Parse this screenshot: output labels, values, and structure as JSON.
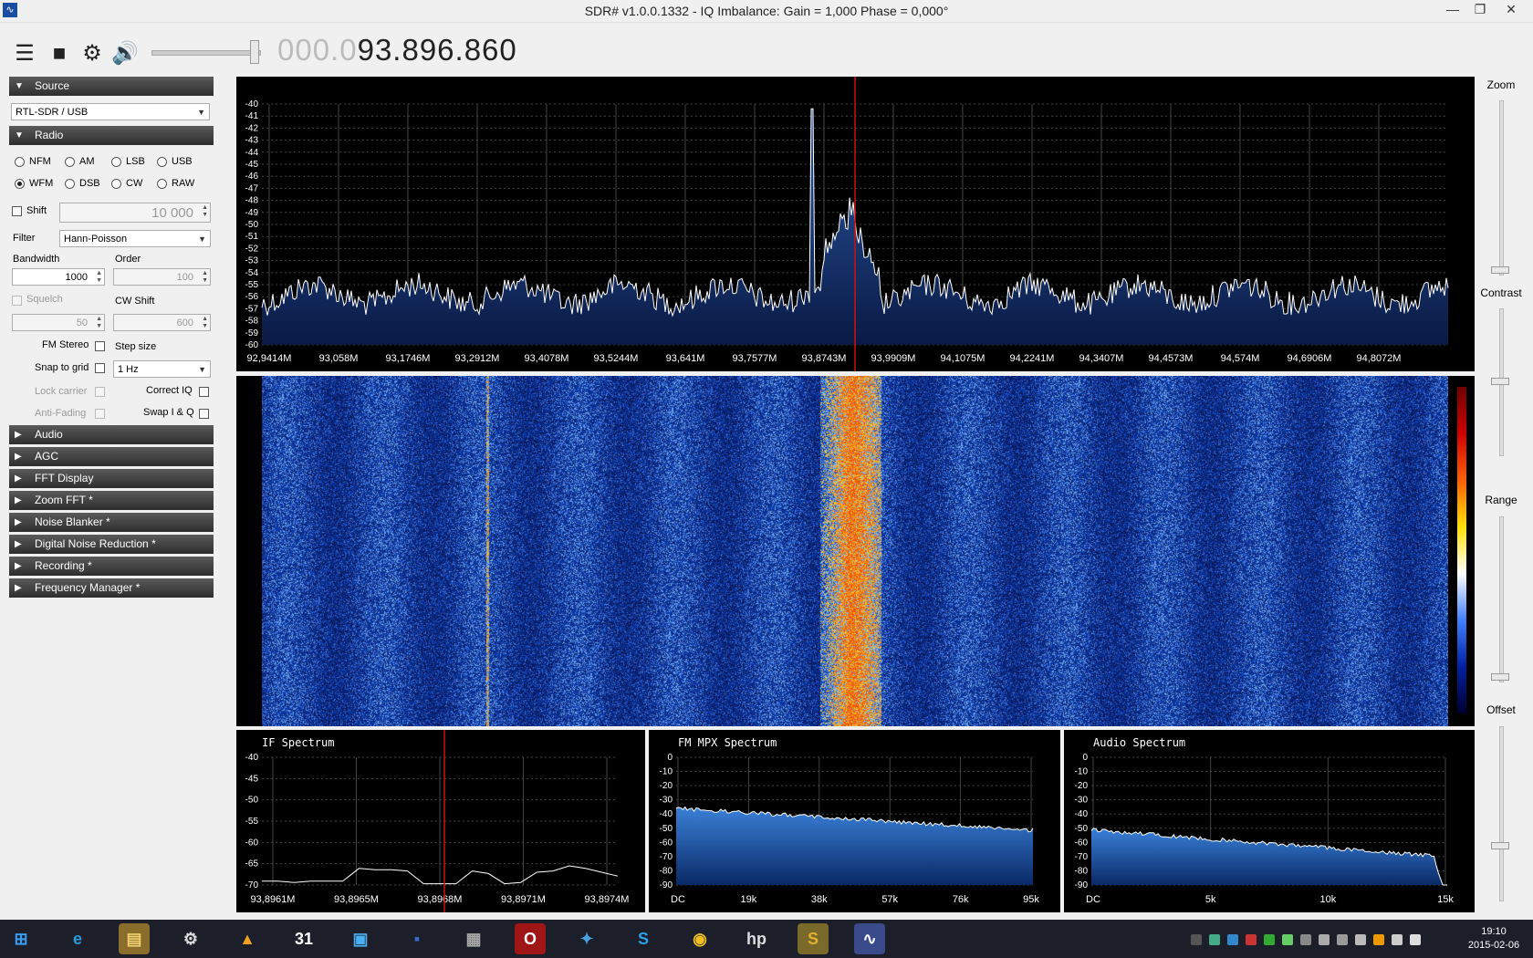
{
  "window": {
    "title": "SDR# v1.0.0.1332 - IQ Imbalance: Gain = 1,000 Phase = 0,000°",
    "controls": [
      "minimize-icon",
      "restore-icon",
      "close-icon"
    ]
  },
  "toolbar": {
    "frequency_dim": "000.0",
    "frequency_main": "93.896.860",
    "icons": [
      "menu-icon",
      "stop-icon",
      "gear-icon",
      "speaker-icon"
    ],
    "volume_level": 0.95
  },
  "sidebar": {
    "source": {
      "label": "Source",
      "device": "RTL-SDR / USB"
    },
    "radio": {
      "label": "Radio",
      "modes": [
        "NFM",
        "AM",
        "LSB",
        "USB",
        "WFM",
        "DSB",
        "CW",
        "RAW"
      ],
      "selected_mode": "WFM",
      "shift_label": "Shift",
      "shift_value": "10 000",
      "filter_label": "Filter",
      "filter_value": "Hann-Poisson",
      "bandwidth_label": "Bandwidth",
      "bandwidth_value": "1000",
      "order_label": "Order",
      "order_value": "100",
      "squelch_label": "Squelch",
      "squelch_value": "50",
      "cw_shift_label": "CW Shift",
      "cw_shift_value": "600",
      "fm_stereo_label": "FM Stereo",
      "step_size_label": "Step size",
      "snap_label": "Snap to grid",
      "step_value": "1 Hz",
      "lock_carrier_label": "Lock carrier",
      "correct_iq_label": "Correct IQ",
      "anti_fading_label": "Anti-Fading",
      "swap_iq_label": "Swap I & Q"
    },
    "collapsed_sections": [
      "Audio",
      "AGC",
      "FFT Display",
      "Zoom FFT *",
      "Noise Blanker *",
      "Digital Noise Reduction *",
      "Recording *",
      "Frequency Manager *"
    ]
  },
  "right_controls": {
    "zoom": "Zoom",
    "zoom_level": 0.0,
    "contrast": "Contrast",
    "contrast_level": 0.5,
    "range": "Range",
    "range_level": 0.0,
    "offset": "Offset",
    "offset_level": 0.3
  },
  "spectrum": {
    "y_ticks": [
      "-40",
      "-41",
      "-42",
      "-43",
      "-44",
      "-45",
      "-46",
      "-47",
      "-48",
      "-49",
      "-50",
      "-51",
      "-52",
      "-53",
      "-54",
      "-55",
      "-56",
      "-57",
      "-58",
      "-59",
      "-60"
    ],
    "x_ticks": [
      "92,9414M",
      "93,058M",
      "93,1746M",
      "93,2912M",
      "93,4078M",
      "93,5244M",
      "93,641M",
      "93,7577M",
      "93,8743M",
      "93,9909M",
      "94,1075M",
      "94,2241M",
      "94,3407M",
      "94,4573M",
      "94,574M",
      "94,6906M",
      "94,8072M"
    ],
    "colors": {
      "fill_top": "#2a5aa8",
      "fill_bottom": "#0a1a44",
      "trace": "#ffffff",
      "tuning_line": "#d01010"
    }
  },
  "if_spectrum": {
    "title": "IF Spectrum",
    "y_ticks": [
      "-40",
      "-45",
      "-50",
      "-55",
      "-60",
      "-65",
      "-70"
    ],
    "x_ticks": [
      "93,8961M",
      "93,8965M",
      "93,8968M",
      "93,8971M",
      "93,8974M"
    ]
  },
  "mpx_spectrum": {
    "title": "FM MPX Spectrum",
    "y_ticks": [
      "0",
      "-10",
      "-20",
      "-30",
      "-40",
      "-50",
      "-60",
      "-70",
      "-80",
      "-90"
    ],
    "x_ticks": [
      "DC",
      "19k",
      "38k",
      "57k",
      "76k",
      "95k"
    ]
  },
  "audio_spectrum": {
    "title": "Audio Spectrum",
    "y_ticks": [
      "0",
      "-10",
      "-20",
      "-30",
      "-40",
      "-50",
      "-60",
      "-70",
      "-80",
      "-90"
    ],
    "x_ticks": [
      "DC",
      "5k",
      "10k",
      "15k"
    ]
  },
  "taskbar": {
    "apps": [
      "windows-start-icon",
      "internet-explorer-icon",
      "file-explorer-icon",
      "steam-icon",
      "vlc-icon",
      "calendar-app-icon",
      "intel-app-icon",
      "save-disk-icon",
      "calculator-icon",
      "opera-icon",
      "bird-app-icon",
      "skype-icon",
      "chrome-icon",
      "hp-icon",
      "sdr-s-icon",
      "sdrsharp-icon"
    ],
    "glyphs": [
      "⊞",
      "e",
      "▤",
      "⚙",
      "▲",
      "31",
      "▣",
      "▪",
      "▦",
      "O",
      "✦",
      "S",
      "◉",
      "hp",
      "S",
      "∿"
    ],
    "time": "19:10",
    "date": "2015-02-06"
  }
}
